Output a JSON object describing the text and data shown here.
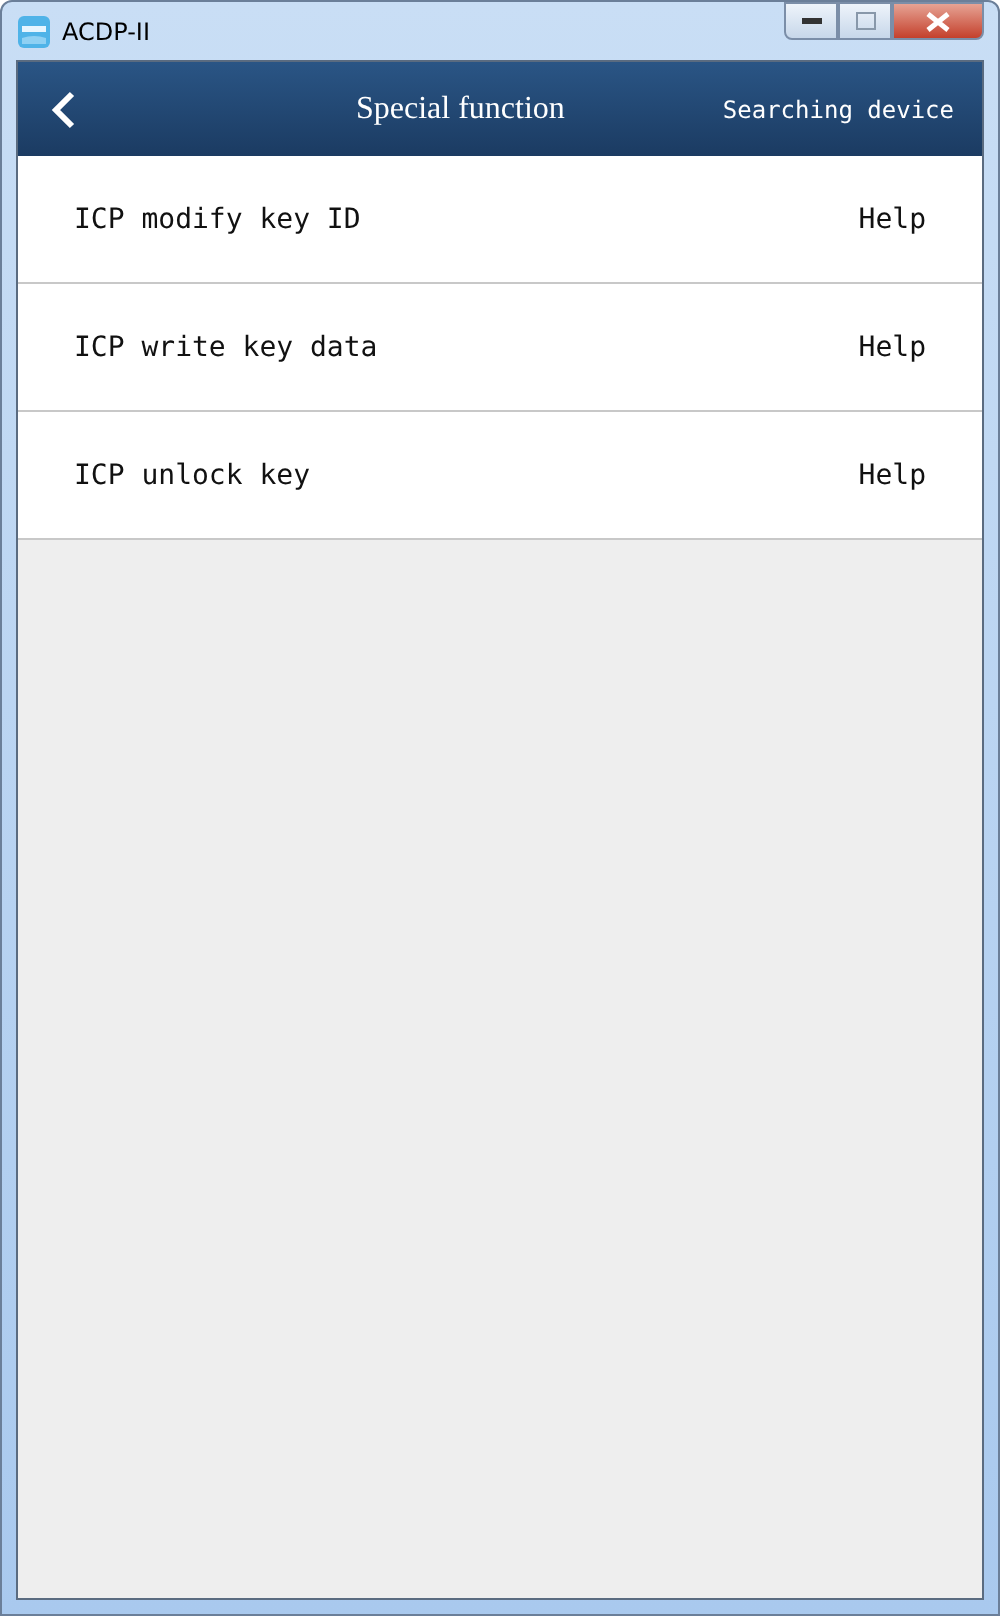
{
  "window": {
    "title": "ACDP-II"
  },
  "header": {
    "title": "Special function",
    "status": "Searching device"
  },
  "items": [
    {
      "label": "ICP modify key ID",
      "help": "Help"
    },
    {
      "label": "ICP write key data",
      "help": "Help"
    },
    {
      "label": "ICP unlock key",
      "help": "Help"
    }
  ]
}
